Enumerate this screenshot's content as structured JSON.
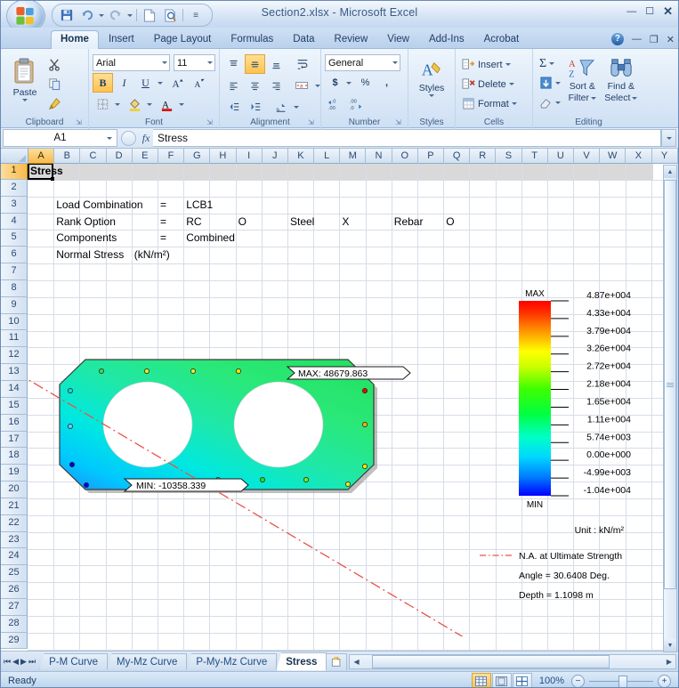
{
  "window": {
    "title": "Section2.xlsx - Microsoft Excel",
    "minimize": "–",
    "maximize": "☐",
    "close": "✕"
  },
  "quick_access": {
    "save": "save-icon",
    "undo": "undo-icon",
    "redo": "redo-icon",
    "new": "new-icon",
    "print_preview": "print-preview-icon",
    "customize": "≡"
  },
  "ribbon": {
    "tabs": [
      {
        "label": "Home",
        "active": true
      },
      {
        "label": "Insert",
        "active": false
      },
      {
        "label": "Page Layout",
        "active": false
      },
      {
        "label": "Formulas",
        "active": false
      },
      {
        "label": "Data",
        "active": false
      },
      {
        "label": "Review",
        "active": false
      },
      {
        "label": "View",
        "active": false
      },
      {
        "label": "Add-Ins",
        "active": false
      },
      {
        "label": "Acrobat",
        "active": false
      }
    ],
    "help": "?",
    "win_min": "–",
    "win_restore": "❐",
    "win_close": "✕",
    "groups": {
      "clipboard": {
        "label": "Clipboard",
        "paste": "Paste",
        "cut": "Cut",
        "copy": "Copy",
        "format_painter": "Format Painter"
      },
      "font": {
        "label": "Font",
        "font_name": "Arial",
        "font_size": "11",
        "bold": "B",
        "italic": "I",
        "underline": "U",
        "grow": "A",
        "shrink": "A",
        "borders": "Borders",
        "fill": "Fill Color",
        "font_color": "Font Color"
      },
      "alignment": {
        "label": "Alignment",
        "top": "Top Align",
        "middle": "Middle Align",
        "bottom": "Bottom Align",
        "left": "Align Left",
        "center": "Center",
        "right": "Align Right",
        "wrap": "Wrap Text",
        "merge": "Merge & Center",
        "indent_dec": "Decrease Indent",
        "indent_inc": "Increase Indent",
        "orientation": "Orientation"
      },
      "number": {
        "label": "Number",
        "format": "General",
        "currency": "$",
        "percent": "%",
        "comma": ",",
        "inc_dec": "Increase Decimal",
        "dec_dec": "Decrease Decimal"
      },
      "styles": {
        "label": "Styles",
        "styles": "Styles"
      },
      "cells": {
        "label": "Cells",
        "insert": "Insert",
        "delete": "Delete",
        "format": "Format"
      },
      "editing": {
        "label": "Editing",
        "autosum": "Σ",
        "fill": "Fill",
        "clear": "Clear",
        "sort_filter_l1": "Sort &",
        "sort_filter_l2": "Filter",
        "find_select_l1": "Find &",
        "find_select_l2": "Select"
      }
    }
  },
  "formula_bar": {
    "name_box": "A1",
    "formula": "Stress",
    "fx": "fx"
  },
  "grid": {
    "columns": [
      "A",
      "B",
      "C",
      "D",
      "E",
      "F",
      "G",
      "H",
      "I",
      "J",
      "K",
      "L",
      "M",
      "N",
      "O",
      "P",
      "Q",
      "R",
      "S",
      "T",
      "U",
      "V",
      "W",
      "X",
      "Y"
    ],
    "selected_column": "A",
    "rows": [
      "1",
      "2",
      "3",
      "4",
      "5",
      "6",
      "7",
      "8",
      "9",
      "10",
      "11",
      "12",
      "13",
      "14",
      "15",
      "16",
      "17",
      "18",
      "19",
      "20",
      "21",
      "22",
      "23",
      "24",
      "25",
      "26",
      "27",
      "28",
      "29"
    ],
    "selected_row": "1",
    "cells": [
      {
        "ref": "A1",
        "text": "Stress",
        "col": 0,
        "row": 0,
        "bold": true
      },
      {
        "ref": "B3",
        "text": "Load Combination",
        "col": 1,
        "row": 2,
        "bold": false
      },
      {
        "ref": "F3",
        "text": "=",
        "col": 5,
        "row": 2,
        "bold": false
      },
      {
        "ref": "G3",
        "text": "LCB1",
        "col": 6,
        "row": 2,
        "bold": false
      },
      {
        "ref": "B4",
        "text": "Rank Option",
        "col": 1,
        "row": 3,
        "bold": false
      },
      {
        "ref": "F4",
        "text": "=",
        "col": 5,
        "row": 3,
        "bold": false
      },
      {
        "ref": "G4",
        "text": "RC",
        "col": 6,
        "row": 3,
        "bold": false
      },
      {
        "ref": "I4",
        "text": "O",
        "col": 8,
        "row": 3,
        "bold": false
      },
      {
        "ref": "K4",
        "text": "Steel",
        "col": 10,
        "row": 3,
        "bold": false
      },
      {
        "ref": "M4",
        "text": "X",
        "col": 12,
        "row": 3,
        "bold": false
      },
      {
        "ref": "O4",
        "text": "Rebar",
        "col": 14,
        "row": 3,
        "bold": false
      },
      {
        "ref": "Q4",
        "text": "O",
        "col": 16,
        "row": 3,
        "bold": false
      },
      {
        "ref": "B5",
        "text": "Components",
        "col": 1,
        "row": 4,
        "bold": false
      },
      {
        "ref": "F5",
        "text": "=",
        "col": 5,
        "row": 4,
        "bold": false
      },
      {
        "ref": "G5",
        "text": "Combined",
        "col": 6,
        "row": 4,
        "bold": false
      },
      {
        "ref": "B6",
        "text": "Normal Stress",
        "col": 1,
        "row": 5,
        "bold": false
      },
      {
        "ref": "E6",
        "text": "(kN/m²)",
        "col": 4,
        "row": 5,
        "bold": false
      }
    ]
  },
  "diagram": {
    "max_label": "MAX: 48679.863",
    "min_label": "MIN: -10358.339",
    "legend_max": "MAX",
    "legend_min": "MIN",
    "unit": "Unit : kN/m²",
    "na_line": "N.A. at Ultimate Strength",
    "angle": "Angle = 30.6408 Deg.",
    "depth": "Depth = 1.1098 m",
    "scale_ticks": [
      "4.87e+004",
      "4.33e+004",
      "3.79e+004",
      "3.26e+004",
      "2.72e+004",
      "2.18e+004",
      "1.65e+004",
      "1.11e+004",
      "5.74e+003",
      "0.00e+000",
      "-4.99e+003",
      "-1.04e+004"
    ],
    "colors": {
      "max": "#ff0000",
      "min": "#0000ff",
      "na_line": "#e8534a"
    }
  },
  "sheet_tabs": {
    "first": "⏮",
    "prev": "◀",
    "next": "▶",
    "last": "⏭",
    "tabs": [
      {
        "label": "P-M Curve",
        "active": false
      },
      {
        "label": "My-Mz Curve",
        "active": false
      },
      {
        "label": "P-My-Mz Curve",
        "active": false
      },
      {
        "label": "Stress",
        "active": true
      }
    ],
    "new_sheet": "new-sheet-icon"
  },
  "status_bar": {
    "mode": "Ready",
    "view_normal": "Normal",
    "view_layout": "Page Layout",
    "view_break": "Page Break Preview",
    "zoom": "100%",
    "zoom_out": "−",
    "zoom_in": "+"
  }
}
